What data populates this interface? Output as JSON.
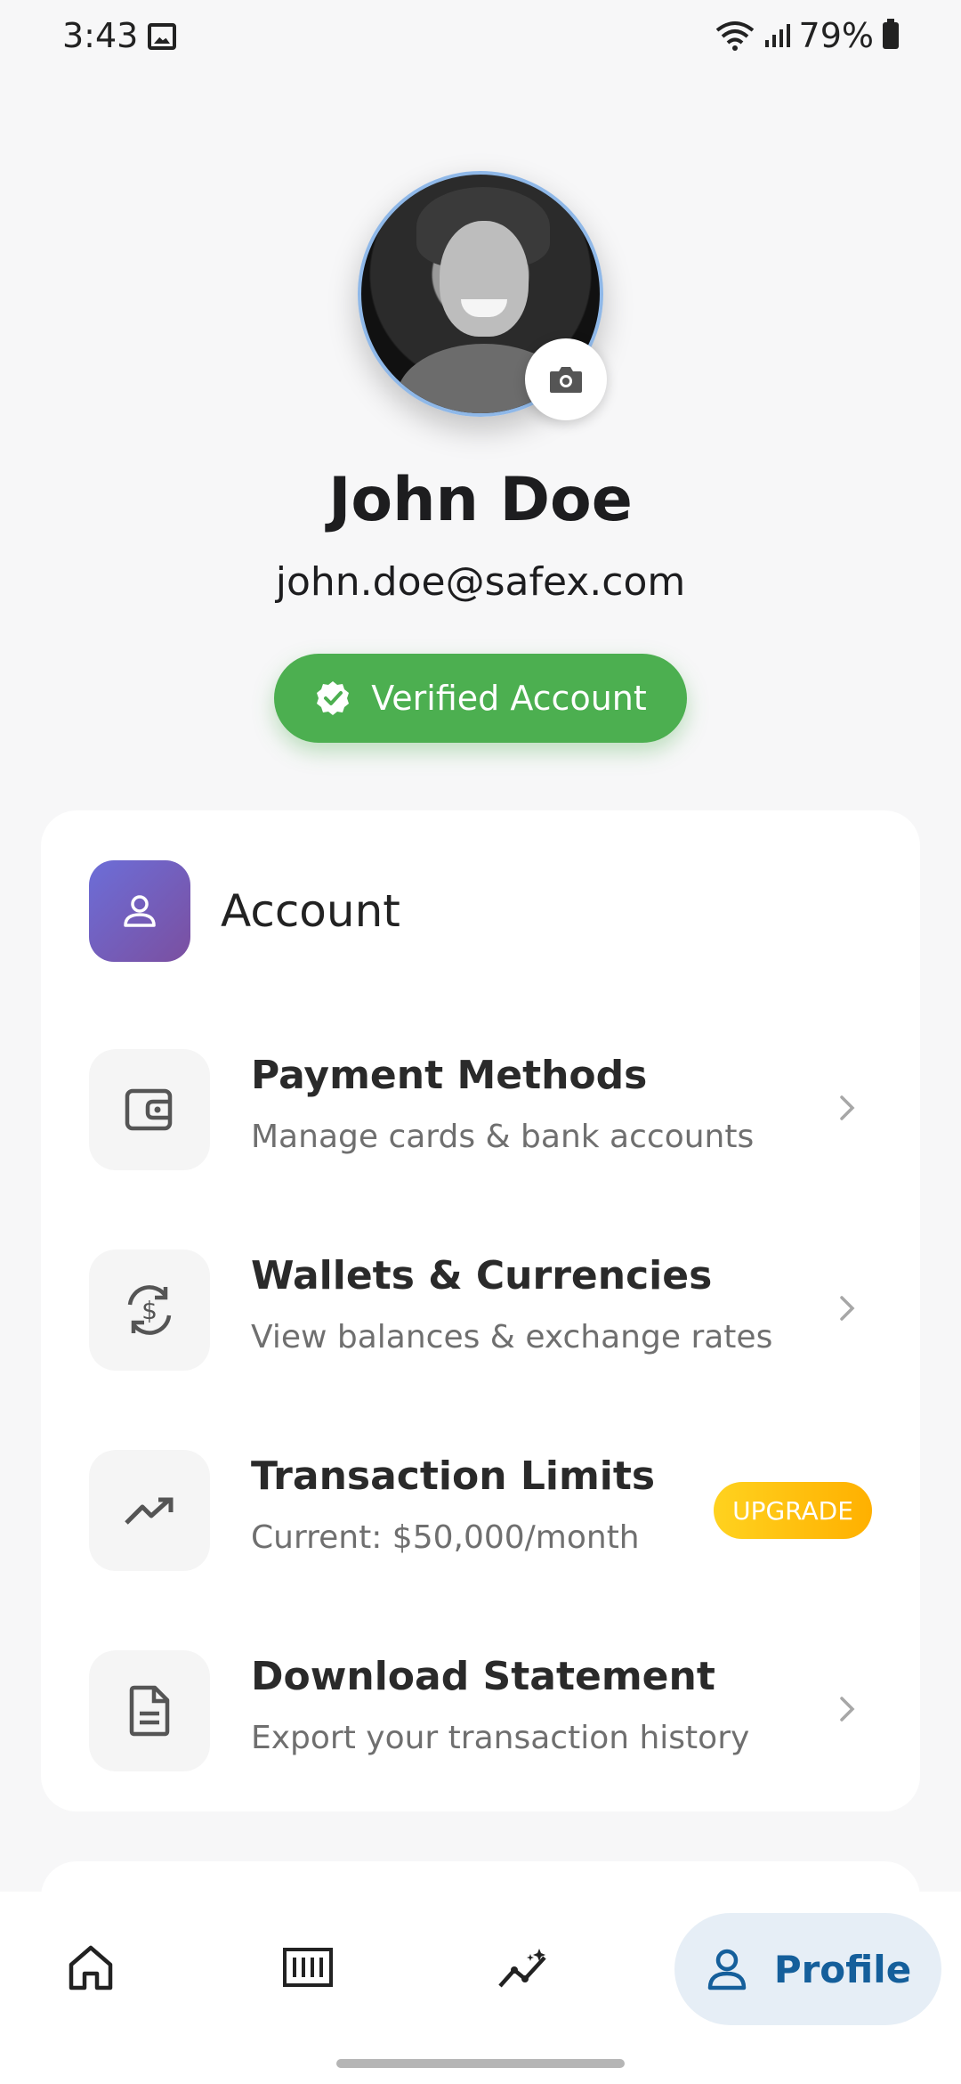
{
  "status_bar": {
    "time": "3:43",
    "battery": "79%"
  },
  "profile": {
    "name": "John Doe",
    "email": "john.doe@safex.com",
    "verified_label": "Verified Account"
  },
  "account_section": {
    "title": "Account",
    "items": [
      {
        "title": "Payment Methods",
        "subtitle": "Manage cards & bank accounts",
        "icon": "wallet-icon"
      },
      {
        "title": "Wallets & Currencies",
        "subtitle": "View balances & exchange rates",
        "icon": "currency-exchange-icon"
      },
      {
        "title": "Transaction Limits",
        "subtitle": "Current: $50,000/month",
        "icon": "trending-up-icon",
        "badge": "UPGRADE"
      },
      {
        "title": "Download Statement",
        "subtitle": "Export your transaction history",
        "icon": "document-icon"
      }
    ]
  },
  "bottom_nav": {
    "items": [
      "home-icon",
      "transactions-icon",
      "analytics-icon"
    ],
    "active_label": "Profile"
  },
  "colors": {
    "verified": "#4caf50",
    "accent": "#155f9b",
    "upgrade": "#ffb000"
  }
}
